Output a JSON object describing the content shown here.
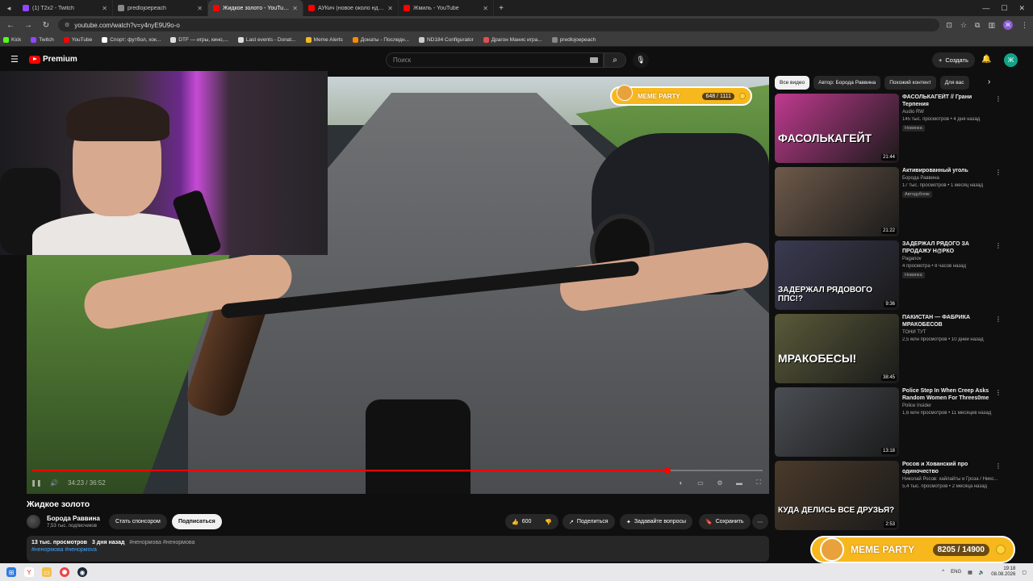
{
  "browser": {
    "tabs": [
      {
        "title": "(1) T2x2 - Twitch",
        "color": "#9146ff"
      },
      {
        "title": "predlojoepeach",
        "color": "#888888"
      },
      {
        "title": "Жидкое золото - YouTube",
        "color": "#ff0000",
        "active": true
      },
      {
        "title": "АУКич (новое около ндеальн",
        "color": "#ff0000"
      },
      {
        "title": "Жмиль - YouTube",
        "color": "#ff0000"
      }
    ],
    "new_tab": "+",
    "url": "youtube.com/watch?v=y4nyE9U9o-o",
    "bookmarks": [
      {
        "label": "Kick",
        "color": "#53fc18"
      },
      {
        "label": "Twitch",
        "color": "#9146ff"
      },
      {
        "label": "YouTube",
        "color": "#ff0000"
      },
      {
        "label": "Спорт: футбол, хок...",
        "color": "#ffffff"
      },
      {
        "label": "DTF — игры, кино,...",
        "color": "#dddddd"
      },
      {
        "label": "Last events - Donat...",
        "color": "#dddddd"
      },
      {
        "label": "Meme Alerts",
        "color": "#f7b81e"
      },
      {
        "label": "Донаты - Последн...",
        "color": "#ff8a00"
      },
      {
        "label": "ND184 Configurator",
        "color": "#cccccc"
      },
      {
        "label": "Драгон Манис игра...",
        "color": "#e05050"
      },
      {
        "label": "predlojoepeach",
        "color": "#888888"
      }
    ]
  },
  "header": {
    "logo": "Premium",
    "search_placeholder": "Поиск",
    "create_label": "Создать",
    "avatar_letter": "Ж"
  },
  "video": {
    "title": "Жидкое золото",
    "time": "34:23 / 36:52",
    "progress": 0.87,
    "meme_label": "MEME PARTY",
    "meme_count": "648 / 1111"
  },
  "channel": {
    "name": "Борода Раввина",
    "subs": "7,53 тыс. подписчиков",
    "sponsor_label": "Стать спонсором",
    "subscribe_label": "Подписаться"
  },
  "actions": {
    "likes": "600",
    "share": "Поделиться",
    "ask": "Задавайте вопросы",
    "save": "Сохранить",
    "more": "⋯"
  },
  "description": {
    "views": "13 тыс. просмотров",
    "ago": "3 дня назад",
    "tags_line1": "#ненормова #ненормова",
    "tags_line2": "#ненормова #ненормova"
  },
  "chips": [
    "Все видео",
    "Автор: Борода Раввина",
    "Похожий контент",
    "Для вас"
  ],
  "recommendations": [
    {
      "title": "ФАСОЛЬКАГЕЙТ // Грани Терпения",
      "channel": "Audio RW",
      "meta": "145 тыс. просмотров • 4 дня назад",
      "badge": "Новинка",
      "duration": "21:44",
      "thumb_text": "ФАСОЛЬКАГЕЙТ",
      "bg": "#c03a8f"
    },
    {
      "title": "Активированный уголь",
      "channel": "Борода Раввина",
      "meta": "17 тыс. просмотров • 1 месяц назад",
      "badge": "Автодубляж",
      "duration": "21:22",
      "thumb_text": "",
      "bg": "#6e5a4a"
    },
    {
      "title": "ЗАДЕРЖАЛ РЯДОГО ЗА ПРОДАЖУ Н@РКО",
      "channel": "Paganov",
      "meta": "4 просмотра • 8 часов назад",
      "badge": "Новинка",
      "duration": "9:36",
      "thumb_text": "ЗАДЕРЖАЛ РЯДОВОГО ППС!?",
      "bg": "#3a3a52"
    },
    {
      "title": "ПАКИСТАН — ФАБРИКА МРАКОБЕСОВ",
      "channel": "ТОНИ ТУТ",
      "meta": "2,5 млн просмотров • 10 дней назад",
      "badge": "",
      "duration": "38:45",
      "thumb_text": "МРАКОБЕСЫ!",
      "bg": "#5a5a3a"
    },
    {
      "title": "Police Step In When Creep Asks Random Women For Threes0me",
      "channel": "Police Insider",
      "meta": "1,6 млн просмотров • 11 месяцев назад",
      "badge": "",
      "duration": "13:18",
      "thumb_text": "",
      "bg": "#4a4e54"
    },
    {
      "title": "Росов и Хованский про одиночество",
      "channel": "Николай Росов: хайлайты и Гроза / Нико...",
      "meta": "5,4 тыс. просмотров • 2 месяца назад",
      "badge": "",
      "duration": "2:53",
      "thumb_text": "КУДА ДЕЛИСЬ ВСЕ ДРУЗЬЯ?",
      "bg": "#4a3a2a"
    }
  ],
  "meme_big": {
    "label": "MEME PARTY",
    "count": "8205 / 14900"
  },
  "taskbar": {
    "lang": "ENG",
    "time": "19:18",
    "date": "08.08.2026"
  }
}
